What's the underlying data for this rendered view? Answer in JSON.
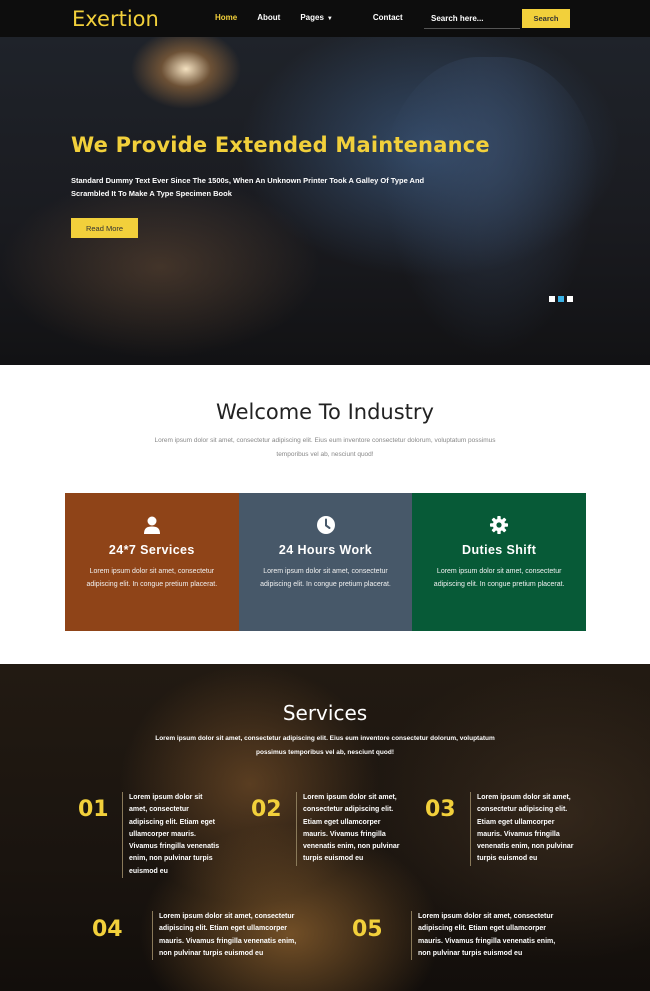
{
  "header": {
    "logo": "Exertion",
    "nav": [
      "Home",
      "About",
      "Pages",
      "Contact"
    ],
    "search_placeholder": "Search here...",
    "search_button": "Search"
  },
  "hero": {
    "title": "We Provide Extended Maintenance",
    "text": "Standard Dummy Text Ever Since The 1500s, When An Unknown Printer Took A Galley Of Type And Scrambled It To Make A Type Specimen Book",
    "button": "Read More",
    "slides": 3,
    "active_slide": 2
  },
  "welcome": {
    "title": "Welcome To Industry",
    "text": "Lorem ipsum dolor sit amet, consectetur adipiscing elit. Eius eum inventore consectetur dolorum, voluptatum possimus temporibus vel ab, nesciunt quod!"
  },
  "features": [
    {
      "icon": "user-icon",
      "title": "24*7 Services",
      "text": "Lorem ipsum dolor sit amet, consectetur adipiscing elit. In congue pretium placerat.",
      "color": "#8f4418"
    },
    {
      "icon": "clock-icon",
      "title": "24 Hours Work",
      "text": "Lorem ipsum dolor sit amet, consectetur adipiscing elit. In congue pretium placerat.",
      "color": "#475869"
    },
    {
      "icon": "gear-icon",
      "title": "Duties Shift",
      "text": "Lorem ipsum dolor sit amet, consectetur adipiscing elit. In congue pretium placerat.",
      "color": "#075a37"
    }
  ],
  "services": {
    "title": "Services",
    "text": "Lorem ipsum dolor sit amet, consectetur adipiscing elit. Eius eum inventore consectetur dolorum, voluptatum possimus temporibus vel ab, nesciunt quod!",
    "items": [
      {
        "number": "01",
        "text": "Lorem ipsum dolor sit amet, consectetur adipiscing elit. Etiam eget ullamcorper mauris. Vivamus fringilla venenatis enim, non pulvinar turpis euismod eu"
      },
      {
        "number": "02",
        "text": "Lorem ipsum dolor sit amet, consectetur adipiscing elit. Etiam eget ullamcorper mauris. Vivamus fringilla venenatis enim, non pulvinar turpis euismod eu"
      },
      {
        "number": "03",
        "text": "Lorem ipsum dolor sit amet, consectetur adipiscing elit. Etiam eget ullamcorper mauris. Vivamus fringilla venenatis enim, non pulvinar turpis euismod eu"
      },
      {
        "number": "04",
        "text": "Lorem ipsum dolor sit amet, consectetur adipiscing elit. Etiam eget ullamcorper mauris. Vivamus fringilla venenatis enim, non pulvinar turpis euismod eu"
      },
      {
        "number": "05",
        "text": "Lorem ipsum dolor sit amet, consectetur adipiscing elit. Etiam eget ullamcorper mauris. Vivamus fringilla venenatis enim, non pulvinar turpis euismod eu"
      }
    ]
  },
  "colors": {
    "accent": "#f2d03b",
    "header_bg": "#0d0d0d",
    "slider_active": "#3bb2e6"
  }
}
